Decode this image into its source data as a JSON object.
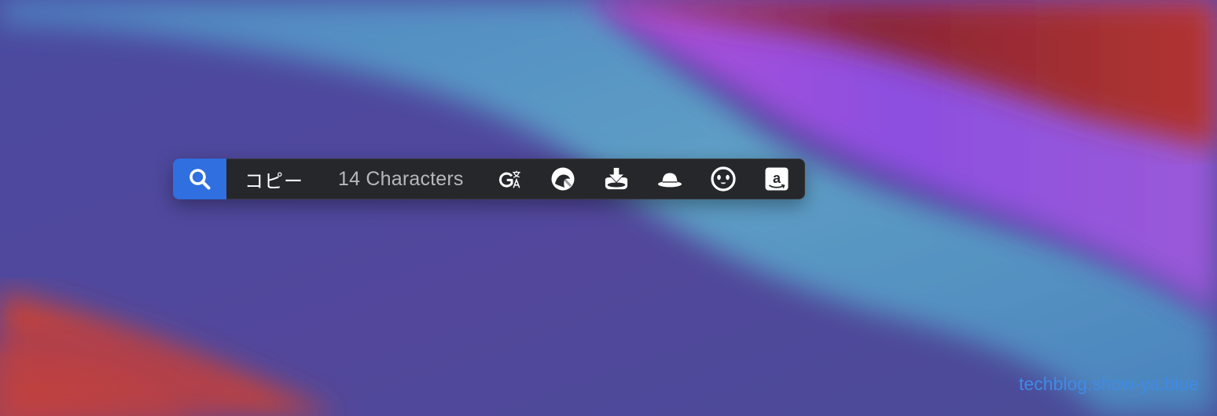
{
  "toolbar": {
    "search_icon": "search-icon",
    "copy_label": "コピー",
    "character_count": "14 Characters",
    "actions": [
      {
        "icon": "google-translate-icon"
      },
      {
        "icon": "deepl-icon"
      },
      {
        "icon": "download-tray-icon"
      },
      {
        "icon": "bowler-hat-icon"
      },
      {
        "icon": "panda-face-icon"
      },
      {
        "icon": "amazon-icon"
      }
    ],
    "accent_color": "#2f6fe0",
    "background_color": "#26272b"
  },
  "watermark": {
    "text": "techblog.show-ya.blue",
    "color": "#3f8ae6"
  }
}
